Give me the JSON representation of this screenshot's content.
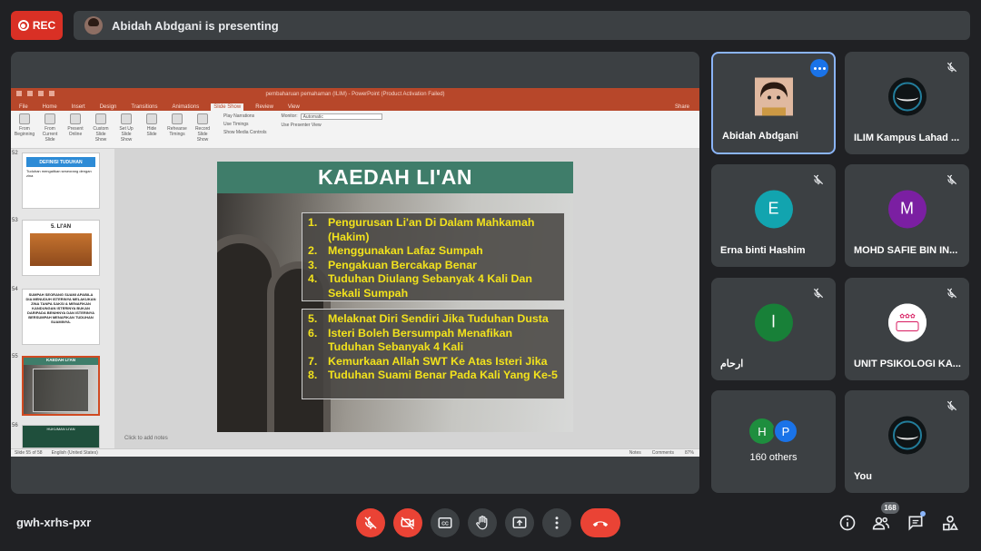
{
  "rec": {
    "label": "REC"
  },
  "presenting": {
    "text": "Abidah Abdgani is presenting"
  },
  "powerpoint": {
    "window_title": "pembaharuan pemahaman (ILIM) - PowerPoint (Product Activation Failed)",
    "tabs": [
      "File",
      "Home",
      "Insert",
      "Design",
      "Transitions",
      "Animations",
      "Slide Show",
      "Review",
      "View"
    ],
    "active_tab": "Slide Show",
    "share": "Share",
    "ribbon": {
      "buttons": [
        "From Beginning",
        "From Current Slide",
        "Present Online",
        "Custom Slide Show",
        "Set Up Slide Show",
        "Hide Slide",
        "Rehearse Timings",
        "Record Slide Show"
      ],
      "checks": [
        "Play Narrations",
        "Use Timings",
        "Show Media Controls"
      ],
      "monitor_label": "Monitor:",
      "monitor_value": "Automatic",
      "presenter_view": "Use Presenter View"
    },
    "thumbnails": [
      {
        "num": "52",
        "title": "DEFINISI TUDUHAN",
        "body": "Tuduhan mengaitkan seseorang dengan zina"
      },
      {
        "num": "53",
        "title": "5. LI'AN"
      },
      {
        "num": "54",
        "body": "SUMPAH SEORANG SUAMI APABILA DIA MENUDUH ISTERINYA MELAKUKAN ZINA TANPA SAKSI & MENAFIKAN KANDUNGAN ISTERINYA BUKAN DARIPADA BENIHNYA DAN ISTERINYA BERSUMPAH MENAFIKAN TUDUHAN SUAMINYA."
      },
      {
        "num": "55",
        "title": "KAEDAH LI'AN"
      },
      {
        "num": "56",
        "title": "HUKUMAN LI'AN"
      }
    ],
    "notes_placeholder": "Click to add notes",
    "status_left": "Slide 55 of 58",
    "status_lang": "English (United States)",
    "status_notes": "Notes",
    "status_comments": "Comments",
    "zoom": "87%",
    "slide": {
      "title": "KAEDAH LI'AN",
      "group1": [
        {
          "n": "1.",
          "text": "Pengurusan Li'an Di Dalam Mahkamah (Hakim)"
        },
        {
          "n": "2.",
          "text": "Menggunakan Lafaz Sumpah"
        },
        {
          "n": "3.",
          "text": "Pengakuan Bercakap Benar"
        },
        {
          "n": "4.",
          "text": "Tuduhan Diulang Sebanyak 4 Kali Dan Sekali Sumpah"
        }
      ],
      "group2": [
        {
          "n": "5.",
          "text": "Melaknat Diri Sendiri Jika Tuduhan Dusta"
        },
        {
          "n": "6.",
          "text": "Isteri Boleh Bersumpah Menafikan Tuduhan Sebanyak 4 Kali"
        },
        {
          "n": "7.",
          "text": "Kemurkaan Allah SWT Ke Atas Isteri Jika"
        },
        {
          "n": "8.",
          "text": "Tuduhan Suami Benar Pada Kali Yang Ke-5"
        }
      ]
    }
  },
  "participants": [
    {
      "name": "Abidah Abdgani",
      "avatar": "photo",
      "active": true
    },
    {
      "name": "ILIM Kampus Lahad ...",
      "avatar": "logo",
      "muted": true
    },
    {
      "name": "Erna binti Hashim",
      "initial": "E",
      "color": "#12a4af",
      "muted": true
    },
    {
      "name": "MOHD SAFIE BIN IN...",
      "initial": "M",
      "color": "#7b1fa2",
      "muted": true
    },
    {
      "name": "ارحام",
      "initial": "ا",
      "color": "#188038",
      "muted": true
    },
    {
      "name": "UNIT PSIKOLOGI KA...",
      "avatar": "unit-logo",
      "muted": true
    },
    {
      "name": "160 others",
      "initials": [
        "H",
        "P"
      ],
      "colors": [
        "#1e8e3e",
        "#1a73e8"
      ]
    },
    {
      "name": "You",
      "avatar": "logo",
      "muted": true
    }
  ],
  "meeting_code": "gwh-xrhs-pxr",
  "people_count": "168",
  "icons": [
    "mic-off-icon",
    "camera-off-icon",
    "captions-icon",
    "raise-hand-icon",
    "present-icon",
    "more-options-icon",
    "end-call-icon",
    "info-icon",
    "people-icon",
    "chat-icon",
    "activities-icon"
  ]
}
